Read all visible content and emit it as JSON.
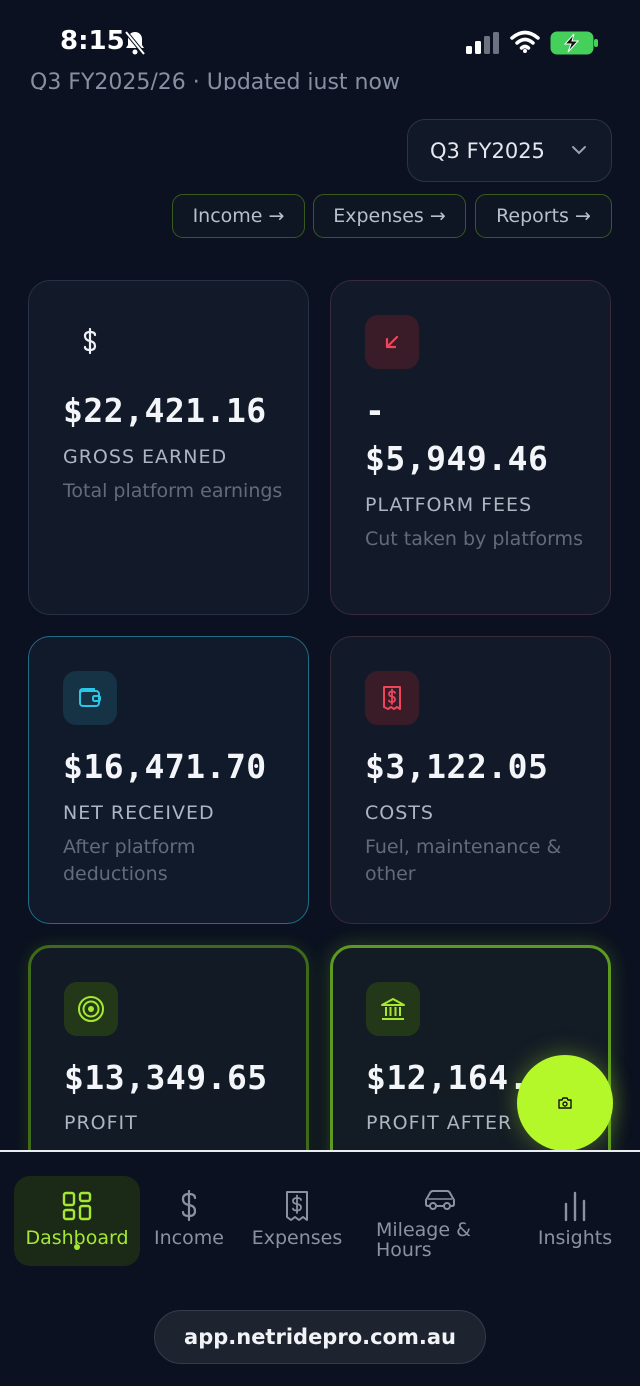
{
  "status_bar": {
    "time": "8:15"
  },
  "header": {
    "subtitle_partial": "Q3 FY2025/26 · Updated just now",
    "quarter_select": "Q3 FY2025",
    "links": [
      "Income →",
      "Expenses →",
      "Reports →"
    ]
  },
  "cards": {
    "gross": {
      "icon": "dollar-icon",
      "value": "$22,421.16",
      "label": "GROSS EARNED",
      "desc": "Total platform earnings"
    },
    "fees": {
      "icon": "arrow-down-left-icon",
      "value_prefix": "-",
      "value": "$5,949.46",
      "label": "PLATFORM FEES",
      "desc": "Cut taken by platforms"
    },
    "net": {
      "icon": "wallet-icon",
      "value": "$16,471.70",
      "label": "NET RECEIVED",
      "desc": "After platform deductions"
    },
    "costs": {
      "icon": "receipt-icon",
      "value": "$3,122.05",
      "label": "COSTS",
      "desc": "Fuel, maintenance & other"
    },
    "profit": {
      "icon": "target-icon",
      "value": "$13,349.65",
      "label": "PROFIT"
    },
    "profit_after": {
      "icon": "bank-icon",
      "value": "$12,164.",
      "label": "PROFIT AFTER"
    }
  },
  "fab": {
    "icon": "camera-icon"
  },
  "nav": {
    "items": [
      {
        "label": "Dashboard",
        "icon": "grid-icon",
        "active": true
      },
      {
        "label": "Income",
        "icon": "dollar-icon"
      },
      {
        "label": "Expenses",
        "icon": "receipt-icon"
      },
      {
        "label": "Mileage & Hours",
        "icon": "car-icon"
      },
      {
        "label": "Insights",
        "icon": "bar-chart-icon"
      }
    ]
  },
  "browser": {
    "url": "app.netridepro.com.au"
  },
  "colors": {
    "accent": "#b4f82a",
    "danger": "#f0445a",
    "info": "#2cc6e8",
    "background": "#0b1120"
  }
}
